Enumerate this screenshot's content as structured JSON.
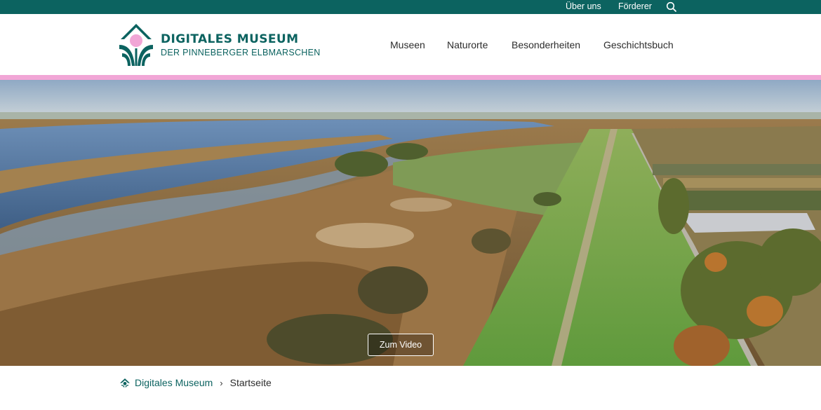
{
  "topbar": {
    "about_label": "Über uns",
    "sponsors_label": "Förderer",
    "search_icon": "search-icon",
    "bg_color": "#0c6360"
  },
  "brand": {
    "title": "DIGITALES MUSEUM",
    "subtitle": "DER PINNEBERGER ELBMARSCHEN",
    "logo_icon": "museum-logo-icon",
    "accent_color": "#0c6360",
    "pink_color": "#f1a6d6"
  },
  "nav": {
    "items": [
      {
        "label": "Museen"
      },
      {
        "label": "Naturorte"
      },
      {
        "label": "Besonderheiten"
      },
      {
        "label": "Geschichtsbuch"
      }
    ]
  },
  "hero": {
    "button_label": "Zum Video"
  },
  "breadcrumb": {
    "home_icon": "home-icon",
    "home_label": "Digitales Museum",
    "separator": "›",
    "current_label": "Startseite"
  }
}
